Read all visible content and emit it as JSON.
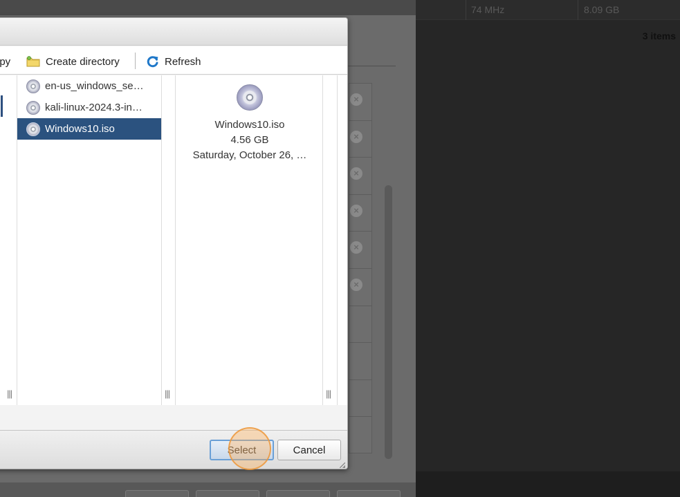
{
  "background": {
    "table_row": {
      "cpu": "74 MHz",
      "memory": "8.09 GB"
    },
    "item_count": "3 items",
    "remove_icon_count": 6
  },
  "dialog": {
    "toolbar": {
      "copy_label": "opy",
      "create_directory_label": "Create directory",
      "refresh_label": "Refresh",
      "folder_icon": "new-folder-icon",
      "refresh_icon": "refresh-icon"
    },
    "files": [
      {
        "name": "en-us_windows_se…",
        "icon": "disc-icon",
        "selected": false
      },
      {
        "name": "kali-linux-2024.3-in…",
        "icon": "disc-icon",
        "selected": false
      },
      {
        "name": "Windows10.iso",
        "icon": "disc-icon",
        "selected": true
      }
    ],
    "preview": {
      "name": "Windows10.iso",
      "size": "4.56 GB",
      "date": "Saturday, October 26, …"
    },
    "column_grip": "|||",
    "buttons": {
      "select": "Select",
      "cancel": "Cancel"
    }
  },
  "colors": {
    "selection": "#2b527f",
    "select_button_border": "#6a9fd6",
    "refresh_icon": "#1f78c9",
    "folder_icon": "#f3d76a",
    "click_indicator": "#f0a050"
  }
}
